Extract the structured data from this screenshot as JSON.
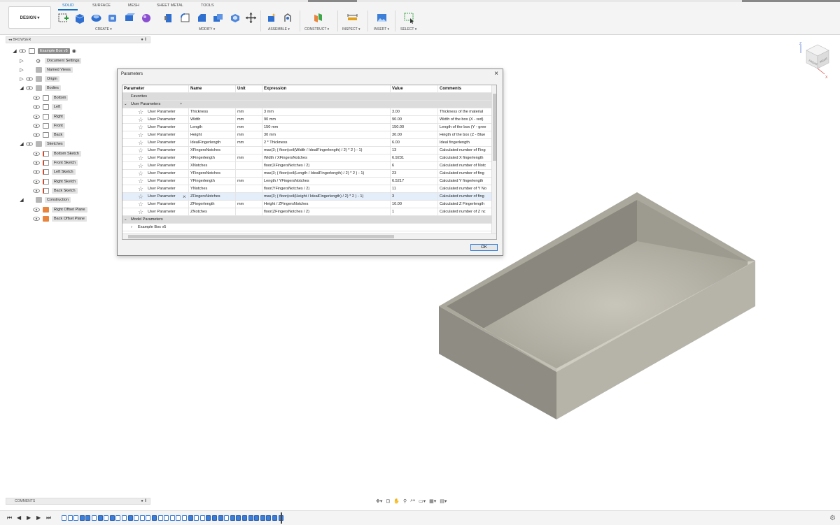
{
  "toolbar": {
    "workspace": "DESIGN ▾",
    "tabs": [
      "SOLID",
      "SURFACE",
      "MESH",
      "SHEET METAL",
      "TOOLS"
    ],
    "groups": [
      "CREATE ▾",
      "MODIFY ▾",
      "ASSEMBLE ▾",
      "CONSTRUCT ▾",
      "INSPECT ▾",
      "INSERT ▾",
      "SELECT ▾"
    ]
  },
  "browser": {
    "title": "BROWSER",
    "root": "Example Box v5",
    "items": [
      {
        "label": "Document Settings"
      },
      {
        "label": "Named Views"
      },
      {
        "label": "Origin"
      },
      {
        "label": "Bodies"
      },
      {
        "label": "Bottom"
      },
      {
        "label": "Left"
      },
      {
        "label": "Right"
      },
      {
        "label": "Front"
      },
      {
        "label": "Back"
      },
      {
        "label": "Sketches"
      },
      {
        "label": "Bottom Sketch"
      },
      {
        "label": "Front Sketch"
      },
      {
        "label": "Left Sketch"
      },
      {
        "label": "Right Sketch"
      },
      {
        "label": "Back Sketch"
      },
      {
        "label": "Construction"
      },
      {
        "label": "Right Offset Plane"
      },
      {
        "label": "Back Offset Plane"
      }
    ]
  },
  "comments": {
    "title": "COMMENTS"
  },
  "dialog": {
    "title": "Parameters",
    "columns": [
      "Parameter",
      "Name",
      "Unit",
      "Expression",
      "Value",
      "Comments"
    ],
    "favorites": "Favorites",
    "user_group": "User Parameters",
    "user_params": [
      {
        "type": "User Parameter",
        "name": "Thickness",
        "unit": "mm",
        "expr": "3 mm",
        "value": "3.00",
        "comment": "Thickness of the material"
      },
      {
        "type": "User Parameter",
        "name": "Width",
        "unit": "mm",
        "expr": "90 mm",
        "value": "90.00",
        "comment": "Width of the box (X - red)"
      },
      {
        "type": "User Parameter",
        "name": "Length",
        "unit": "mm",
        "expr": "150 mm",
        "value": "150.00",
        "comment": "Length of the box (Y - gree"
      },
      {
        "type": "User Parameter",
        "name": "Height",
        "unit": "mm",
        "expr": "30 mm",
        "value": "30.00",
        "comment": "Heigth of the box (Z - Blue"
      },
      {
        "type": "User Parameter",
        "name": "IdealFingerlength",
        "unit": "mm",
        "expr": "2 * Thickness",
        "value": "6.00",
        "comment": "Ideal fingerlength"
      },
      {
        "type": "User Parameter",
        "name": "XFingersNotches",
        "unit": "",
        "expr": "max(3; ( floor(ceil(Width / IdealFingerlength) / 2) * 2 ) - 1)",
        "value": "13",
        "comment": "Calculated number of Fing"
      },
      {
        "type": "User Parameter",
        "name": "XFingerlength",
        "unit": "mm",
        "expr": "Width / XFingersNotches",
        "value": "6.9231",
        "comment": "Calculated X fingerlength"
      },
      {
        "type": "User Parameter",
        "name": "XNotches",
        "unit": "",
        "expr": "floor(XFingersNotches / 2)",
        "value": "6",
        "comment": "Calculated number of Notc"
      },
      {
        "type": "User Parameter",
        "name": "YFingersNotches",
        "unit": "",
        "expr": "max(3; ( floor(ceil(Length / IdealFingerlength) / 2) * 2 ) - 1)",
        "value": "23",
        "comment": "Calculated number of fing"
      },
      {
        "type": "User Parameter",
        "name": "YFingerlength",
        "unit": "mm",
        "expr": "Length / YFingersNotches",
        "value": "6.5217",
        "comment": "Calculated Y fingerlength"
      },
      {
        "type": "User Parameter",
        "name": "YNotches",
        "unit": "",
        "expr": "floor(YFingersNotches / 2)",
        "value": "11",
        "comment": "Calculated number of Y No"
      },
      {
        "type": "User Parameter",
        "name": "ZFingersNotches",
        "unit": "",
        "expr": "max(3; ( floor(ceil(Height / IdealFingerlength) / 2) * 2 ) - 1)",
        "value": "3",
        "comment": "Calculated number of fing"
      },
      {
        "type": "User Parameter",
        "name": "ZFingerlength",
        "unit": "mm",
        "expr": "Height / ZFingersNotches",
        "value": "10.00",
        "comment": "Calculated Z Fingerlength"
      },
      {
        "type": "User Parameter",
        "name": "ZNotches",
        "unit": "",
        "expr": "floor(ZFingersNotches / 2)",
        "value": "1",
        "comment": "Calculated number of Z nc"
      }
    ],
    "model_group": "Model Parameters",
    "model_item": "Example Box v5",
    "ok": "OK"
  },
  "colors": {
    "accent": "#0f6fc6",
    "box_top": "#a8a59a",
    "box_left": "#96938a",
    "box_right": "#bdbab0"
  }
}
